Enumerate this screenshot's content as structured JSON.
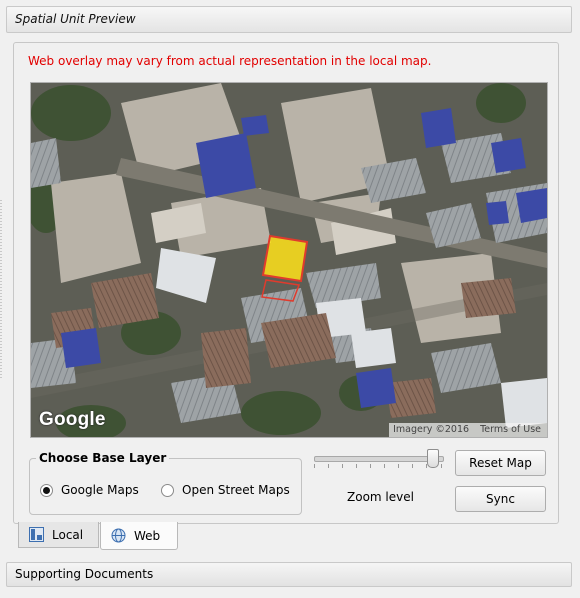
{
  "panel": {
    "title": "Spatial Unit Preview"
  },
  "warning": "Web overlay may vary from actual representation in the local map.",
  "map": {
    "logo": "Google",
    "attribution": "Imagery ©2016",
    "terms": "Terms of Use"
  },
  "base_layer": {
    "legend": "Choose Base Layer",
    "options": [
      {
        "label": "Google Maps",
        "selected": true
      },
      {
        "label": "Open Street Maps",
        "selected": false
      }
    ]
  },
  "zoom": {
    "label": "Zoom level",
    "level_fraction": 0.92
  },
  "buttons": {
    "reset": "Reset Map",
    "sync": "Sync"
  },
  "tabs": [
    {
      "label": "Local",
      "icon": "local-map-icon",
      "active": false
    },
    {
      "label": "Web",
      "icon": "web-globe-icon",
      "active": true
    }
  ],
  "bottom_section": {
    "title": "Supporting Documents"
  },
  "colors": {
    "warning": "#e20000",
    "parcel_fill": "#ffe21a",
    "parcel_outline": "#e03b2d"
  }
}
